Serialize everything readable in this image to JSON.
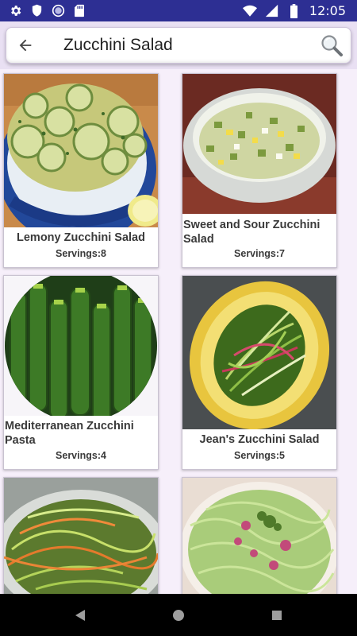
{
  "status_bar": {
    "time": "12:05",
    "left_icons": [
      "gear-icon",
      "shield-icon",
      "circle-icon",
      "sd-card-icon"
    ],
    "right_icons": [
      "wifi-icon",
      "signal-icon",
      "battery-icon"
    ]
  },
  "search": {
    "query": "Zucchini Salad",
    "back_icon": "arrow-back-icon",
    "search_icon": "magnifier-icon"
  },
  "recipes": [
    {
      "name": "Lemony Zucchini Salad",
      "servings": "Servings:8"
    },
    {
      "name": "Sweet and Sour Zucchini Salad",
      "servings": "Servings:7"
    },
    {
      "name": "Mediterranean Zucchini Pasta",
      "servings": "Servings:4"
    },
    {
      "name": "Jean's Zucchini Salad",
      "servings": "Servings:5"
    },
    {
      "name": "",
      "servings": ""
    },
    {
      "name": "",
      "servings": ""
    }
  ],
  "nav": {
    "back_icon": "triangle-back-icon",
    "home_icon": "circle-home-icon",
    "recents_icon": "square-recents-icon"
  },
  "colors": {
    "status_bar": "#2d2f93",
    "background": "#f6effa",
    "app_bar": "#e9e0f3"
  }
}
